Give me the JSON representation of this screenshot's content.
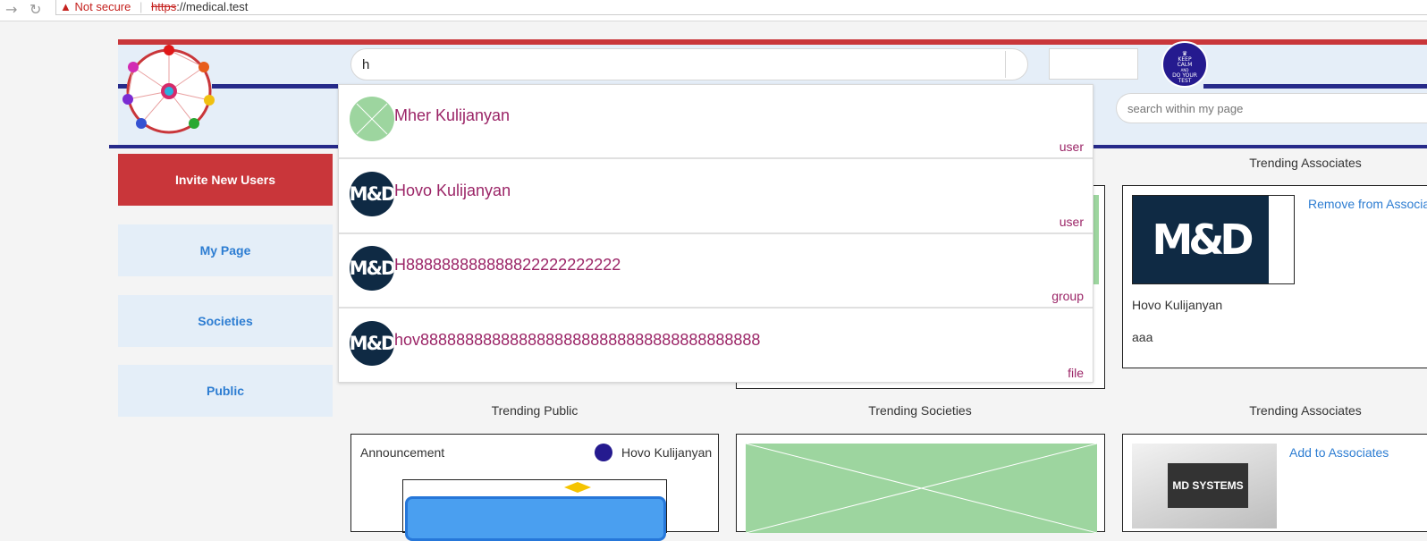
{
  "browser": {
    "back_icon": "arrow-right-icon",
    "reload_icon": "reload-icon",
    "warning_icon": "warning-triangle-icon",
    "security_text": "Not secure",
    "url_scheme": "https",
    "url_rest": "://medical.test"
  },
  "header": {
    "search_value": "h",
    "search_within_placeholder": "search within my page",
    "badge_lines": [
      "KEEP",
      "CALM",
      "AND",
      "DO YOUR",
      "TEST"
    ],
    "colors": {
      "red": "#c9363a",
      "navy": "#262a8a",
      "light": "#e5eef8"
    }
  },
  "sidebar": {
    "invite_label": "Invite New Users",
    "items": [
      {
        "label": "My Page"
      },
      {
        "label": "Societies"
      },
      {
        "label": "Public"
      }
    ]
  },
  "dropdown": {
    "results": [
      {
        "name": "Mher Kulijanyan",
        "type": "user",
        "avatar": "placeholder"
      },
      {
        "name": "Hovo Kulijanyan",
        "type": "user",
        "avatar": "md-logo"
      },
      {
        "name": "H888888888888822222222222",
        "type": "group",
        "avatar": "md-logo"
      },
      {
        "name": "hov88888888888888888888888888888888888888",
        "type": "file",
        "avatar": "md-logo"
      }
    ]
  },
  "trending": {
    "top_right_title": "Trending Associates",
    "top_right_card": {
      "logo": "M&D",
      "action": "Remove from Associates",
      "name": "Hovo Kulijanyan",
      "text": "aaa"
    },
    "bottom_titles": [
      "Trending Public",
      "Trending Societies",
      "Trending Associates"
    ],
    "public_card": {
      "title": "Announcement",
      "author": "Hovo Kulijanyan"
    },
    "associates_card": {
      "action": "Add to Associates",
      "logo": "MD SYSTEMS"
    }
  }
}
